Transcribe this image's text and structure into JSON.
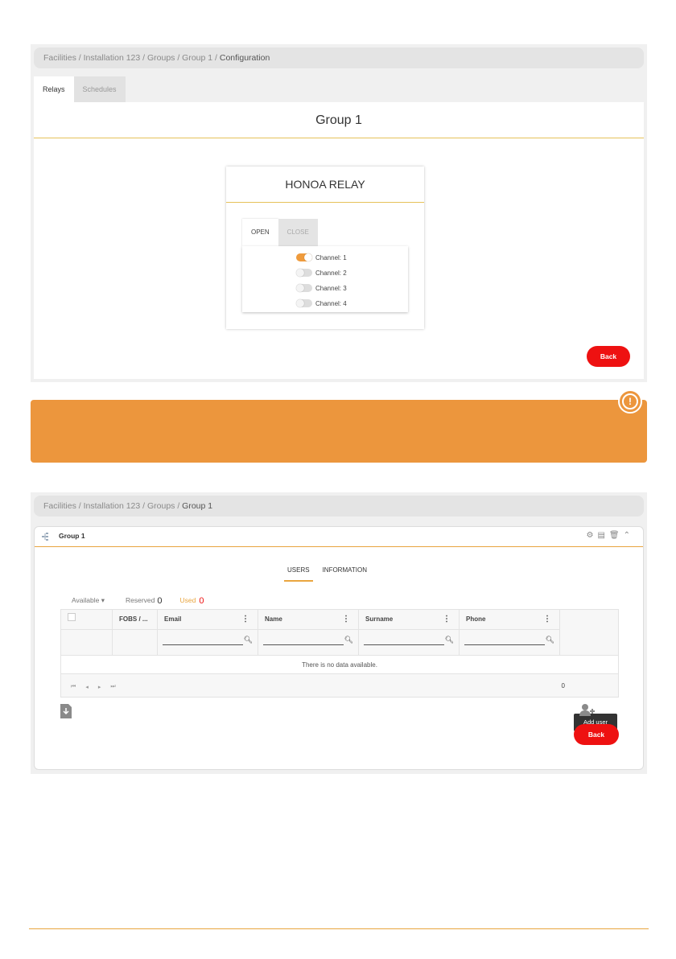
{
  "config": {
    "breadcrumb": {
      "path": "Facilities / Installation 123 / Groups / Group 1 /",
      "current": "Configuration"
    },
    "tabs": [
      {
        "label": "Relays",
        "active": true
      },
      {
        "label": "Schedules",
        "active": false
      }
    ],
    "group_title": "Group 1",
    "relay": {
      "title": "HONOA RELAY",
      "tabs": [
        {
          "label": "OPEN",
          "active": true
        },
        {
          "label": "CLOSE",
          "active": false
        }
      ],
      "channels": [
        {
          "label": "Channel: 1",
          "on": true
        },
        {
          "label": "Channel: 2",
          "on": false
        },
        {
          "label": "Channel: 3",
          "on": false
        },
        {
          "label": "Channel: 4",
          "on": false
        }
      ]
    },
    "back_label": "Back"
  },
  "banner": {
    "icon": "exclamation-circle-icon",
    "color": "#ec963d"
  },
  "group": {
    "breadcrumb": {
      "path": "Facilities / Installation 123 / Groups /",
      "current": "Group 1"
    },
    "card_title": "Group 1",
    "header_icons": [
      "gear-icon",
      "pdf-icon",
      "trash-icon",
      "chevron-up-icon"
    ],
    "tabs": [
      {
        "label": "USERS",
        "active": true
      },
      {
        "label": "INFORMATION",
        "active": false
      }
    ],
    "stats": {
      "available_label": "Available",
      "reserved_label": "Reserved",
      "reserved_value": "0",
      "used_label": "Used",
      "used_value": "0"
    },
    "columns": [
      "FOBS / ...",
      "Email",
      "Name",
      "Surname",
      "Phone"
    ],
    "empty_text": "There is no data available.",
    "total": "0",
    "tooltip": "Add user",
    "back_label": "Back"
  },
  "accent_color": "#e9a53f",
  "danger_color": "#ee1111"
}
